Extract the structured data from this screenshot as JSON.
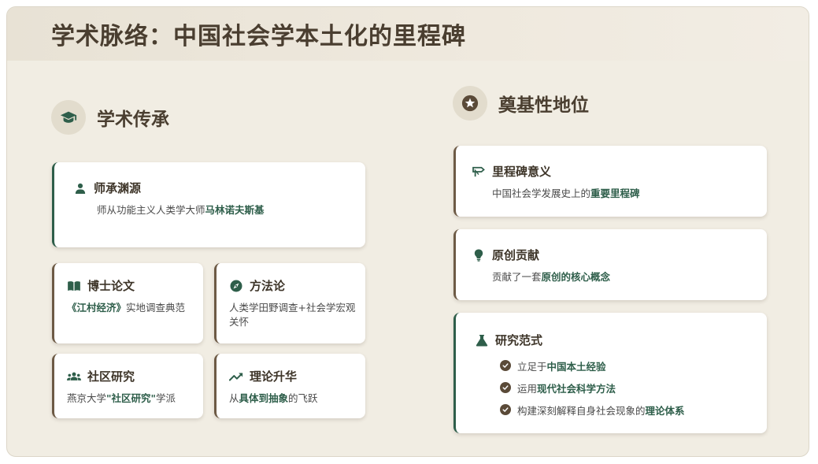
{
  "page": {
    "title": "学术脉络：中国社会学本土化的里程碑"
  },
  "left_section": {
    "title": "学术传承",
    "icon": "graduation-cap-icon",
    "cards": {
      "mentor": {
        "title": "师承渊源",
        "icon": "person-icon",
        "desc_plain": "师从功能主义人类学大师",
        "desc_bold": "马林诺夫斯基"
      },
      "phd": {
        "title": "博士论文",
        "icon": "book-icon",
        "desc_bold": "《江村经济》",
        "desc_plain": "实地调查典范"
      },
      "method": {
        "title": "方法论",
        "icon": "compass-icon",
        "desc_plain": "人类学田野调查+社会学宏观关怀"
      },
      "community": {
        "title": "社区研究",
        "icon": "users-icon",
        "desc_pre": "燕京大学",
        "desc_bold": "\"社区研究\"",
        "desc_post": "学派"
      },
      "theory": {
        "title": "理论升华",
        "icon": "trend-up-icon",
        "desc_pre": "从",
        "desc_bold": "具体到抽象",
        "desc_post": "的飞跃"
      }
    }
  },
  "right_section": {
    "title": "奠基性地位",
    "icon": "star-icon",
    "cards": {
      "milestone": {
        "title": "里程碑意义",
        "icon": "signpost-icon",
        "desc_plain": "中国社会学发展史上的",
        "desc_bold": "重要里程碑"
      },
      "original": {
        "title": "原创贡献",
        "icon": "lightbulb-icon",
        "desc_plain": "贡献了一套",
        "desc_bold": "原创的核心概念"
      },
      "paradigm": {
        "title": "研究范式",
        "icon": "flask-icon",
        "items": [
          {
            "pre": "立足于",
            "bold": "中国本土经验"
          },
          {
            "pre": "运用",
            "bold": "现代社会科学方法"
          },
          {
            "pre": "构建深刻解释自身社会现象的",
            "bold": "理论体系"
          }
        ]
      }
    }
  },
  "colors": {
    "accent_green": "#2e5e4a",
    "accent_brown": "#6d5a45",
    "background": "#f1ede3"
  }
}
